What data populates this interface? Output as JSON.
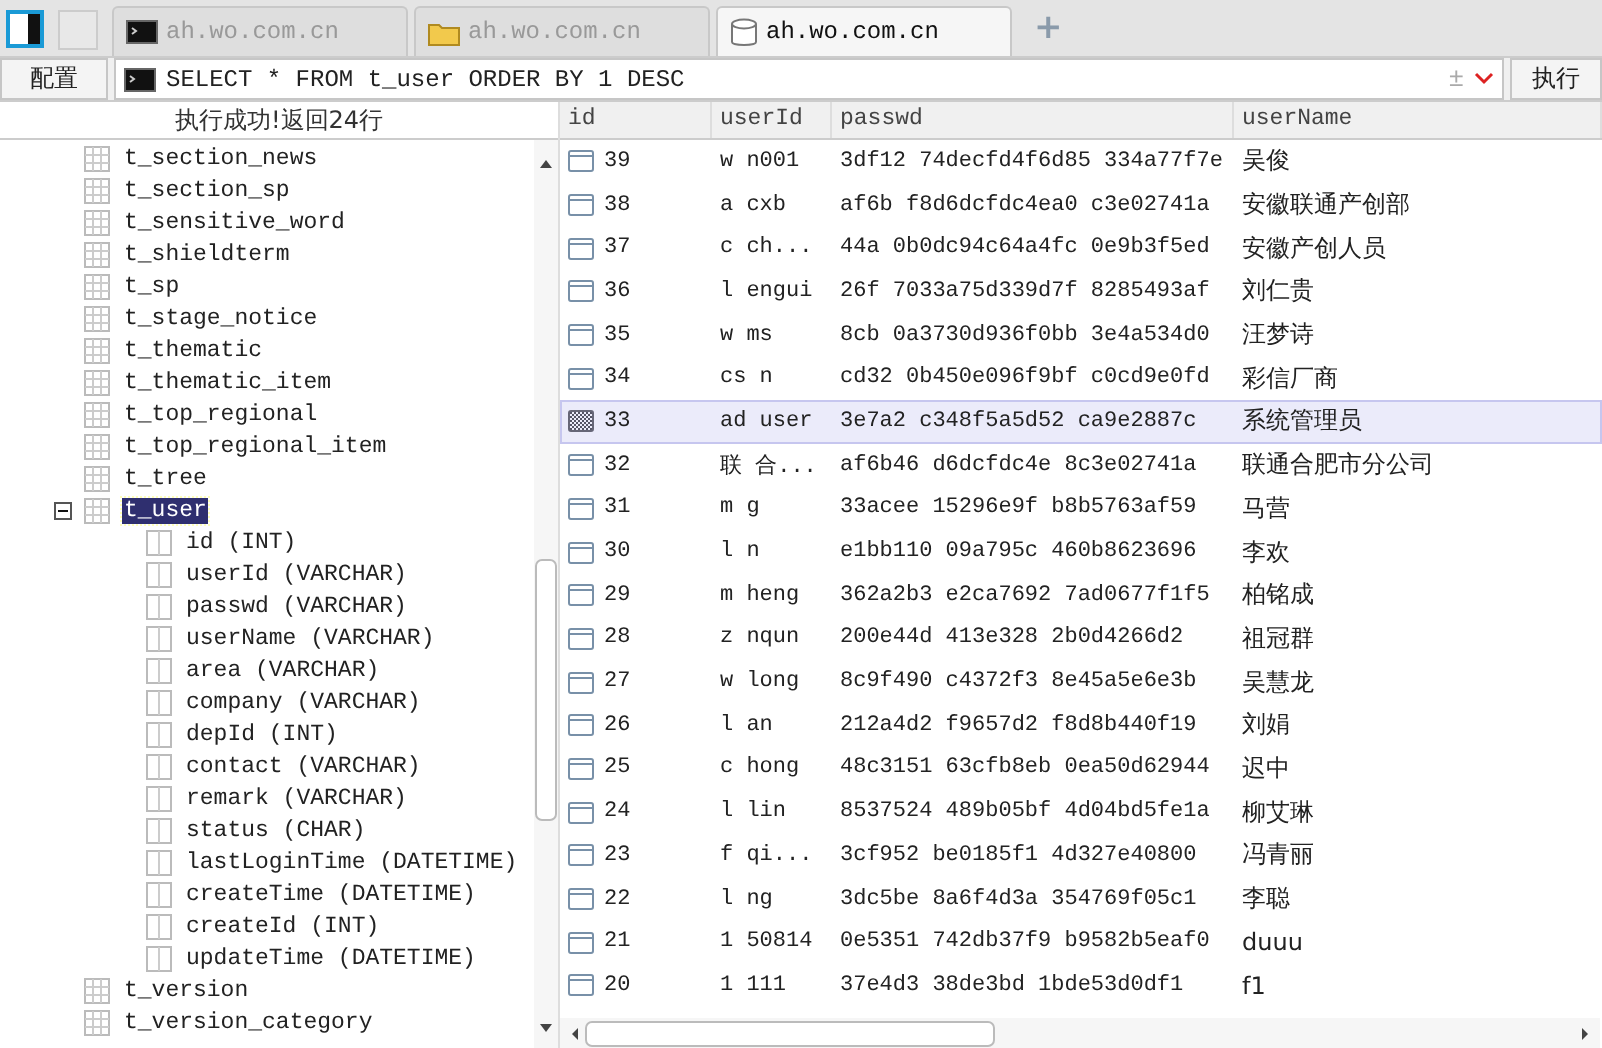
{
  "tabs": [
    {
      "kind": "terminal",
      "label": "ah.wo.com.cn",
      "selected": false
    },
    {
      "kind": "folder",
      "label": "ah.wo.com.cn",
      "selected": false
    },
    {
      "kind": "database",
      "label": "ah.wo.com.cn",
      "selected": true
    }
  ],
  "add_tab": "+",
  "toolbar": {
    "config_button": "配置",
    "query": "SELECT * FROM t_user ORDER BY 1 DESC",
    "toggle": "±",
    "run_button": "执行"
  },
  "status": "执行成功!返回24行",
  "tree": [
    {
      "kind": "table",
      "label": "t_section_news",
      "selected": false
    },
    {
      "kind": "table",
      "label": "t_section_sp",
      "selected": false
    },
    {
      "kind": "table",
      "label": "t_sensitive_word",
      "selected": false
    },
    {
      "kind": "table",
      "label": "t_shieldterm",
      "selected": false
    },
    {
      "kind": "table",
      "label": "t_sp",
      "selected": false
    },
    {
      "kind": "table",
      "label": "t_stage_notice",
      "selected": false
    },
    {
      "kind": "table",
      "label": "t_thematic",
      "selected": false
    },
    {
      "kind": "table",
      "label": "t_thematic_item",
      "selected": false
    },
    {
      "kind": "table",
      "label": "t_top_regional",
      "selected": false
    },
    {
      "kind": "table",
      "label": "t_top_regional_item",
      "selected": false
    },
    {
      "kind": "table",
      "label": "t_tree",
      "selected": false
    },
    {
      "kind": "table",
      "label": "t_user",
      "selected": true,
      "expanded": true,
      "children": [
        {
          "kind": "column",
          "label": "id (INT)",
          "selected": false
        },
        {
          "kind": "column",
          "label": "userId (VARCHAR)",
          "selected": false
        },
        {
          "kind": "column",
          "label": "passwd (VARCHAR)",
          "selected": false
        },
        {
          "kind": "column",
          "label": "userName (VARCHAR)",
          "selected": false
        },
        {
          "kind": "column",
          "label": "area (VARCHAR)",
          "selected": false
        },
        {
          "kind": "column",
          "label": "company (VARCHAR)",
          "selected": false
        },
        {
          "kind": "column",
          "label": "depId (INT)",
          "selected": false
        },
        {
          "kind": "column",
          "label": "contact (VARCHAR)",
          "selected": false
        },
        {
          "kind": "column",
          "label": "remark (VARCHAR)",
          "selected": false
        },
        {
          "kind": "column",
          "label": "status (CHAR)",
          "selected": false
        },
        {
          "kind": "column",
          "label": "lastLoginTime (DATETIME)",
          "selected": false
        },
        {
          "kind": "column",
          "label": "createTime (DATETIME)",
          "selected": false
        },
        {
          "kind": "column",
          "label": "createId (INT)",
          "selected": false
        },
        {
          "kind": "column",
          "label": "updateTime (DATETIME)",
          "selected": false
        }
      ]
    },
    {
      "kind": "table",
      "label": "t_version",
      "selected": false
    },
    {
      "kind": "table",
      "label": "t_version_category",
      "selected": false
    }
  ],
  "table": {
    "columns": [
      "id",
      "userId",
      "passwd",
      "userName"
    ],
    "rows": [
      {
        "selected": false,
        "cells": [
          "39",
          "w n001",
          "3df12 74decfd4f6d85 334a77f7e",
          "吴俊"
        ]
      },
      {
        "selected": false,
        "cells": [
          "38",
          "a cxb",
          "af6b f8d6dcfdc4ea0 c3e02741a",
          "安徽联通产创部"
        ]
      },
      {
        "selected": false,
        "cells": [
          "37",
          "c ch...",
          "44a 0b0dc94c64a4fc 0e9b3f5ed",
          "安徽产创人员"
        ]
      },
      {
        "selected": false,
        "cells": [
          "36",
          "l engui",
          "26f 7033a75d339d7f 8285493af",
          "刘仁贵"
        ]
      },
      {
        "selected": false,
        "cells": [
          "35",
          "w ms",
          "8cb 0a3730d936f0bb 3e4a534d0",
          "汪梦诗"
        ]
      },
      {
        "selected": false,
        "cells": [
          "34",
          "cs n",
          "cd32 0b450e096f9bf c0cd9e0fd",
          "彩信厂商"
        ]
      },
      {
        "selected": true,
        "cells": [
          "33",
          "ad user",
          "3e7a2 c348f5a5d52 ca9e2887c",
          "系统管理员"
        ]
      },
      {
        "selected": false,
        "cells": [
          "32",
          "联 合...",
          "af6b46 d6dcfdc4e 8c3e02741a",
          "联通合肥市分公司"
        ]
      },
      {
        "selected": false,
        "cells": [
          "31",
          "m g",
          "33acee 15296e9f b8b5763af59",
          "马营"
        ]
      },
      {
        "selected": false,
        "cells": [
          "30",
          "l n",
          "e1bb110 09a795c 460b8623696",
          "李欢"
        ]
      },
      {
        "selected": false,
        "cells": [
          "29",
          "m heng",
          "362a2b3 e2ca7692 7ad0677f1f5",
          "柏铭成"
        ]
      },
      {
        "selected": false,
        "cells": [
          "28",
          "z nqun",
          "200e44d 413e328 2b0d4266d2",
          "祖冠群"
        ]
      },
      {
        "selected": false,
        "cells": [
          "27",
          "w long",
          "8c9f490 c4372f3 8e45a5e6e3b",
          "吴慧龙"
        ]
      },
      {
        "selected": false,
        "cells": [
          "26",
          "l an",
          "212a4d2 f9657d2 f8d8b440f19",
          "刘娟"
        ]
      },
      {
        "selected": false,
        "cells": [
          "25",
          "c hong",
          "48c3151 63cfb8eb 0ea50d62944",
          "迟中"
        ]
      },
      {
        "selected": false,
        "cells": [
          "24",
          "l lin",
          "8537524 489b05bf 4d04bd5fe1a",
          "柳艾琳"
        ]
      },
      {
        "selected": false,
        "cells": [
          "23",
          "f qi...",
          "3cf952 be0185f1 4d327e40800",
          "冯青丽"
        ]
      },
      {
        "selected": false,
        "cells": [
          "22",
          "l ng",
          "3dc5be 8a6f4d3a 354769f05c1",
          "李聪"
        ]
      },
      {
        "selected": false,
        "cells": [
          "21",
          "1 50814",
          "0e5351 742db37f9 b9582b5eaf0",
          "duuu"
        ]
      },
      {
        "selected": false,
        "cells": [
          "20",
          "1 111",
          "37e4d3 38de3bd 1bde53d0df1",
          "f1"
        ]
      }
    ]
  }
}
